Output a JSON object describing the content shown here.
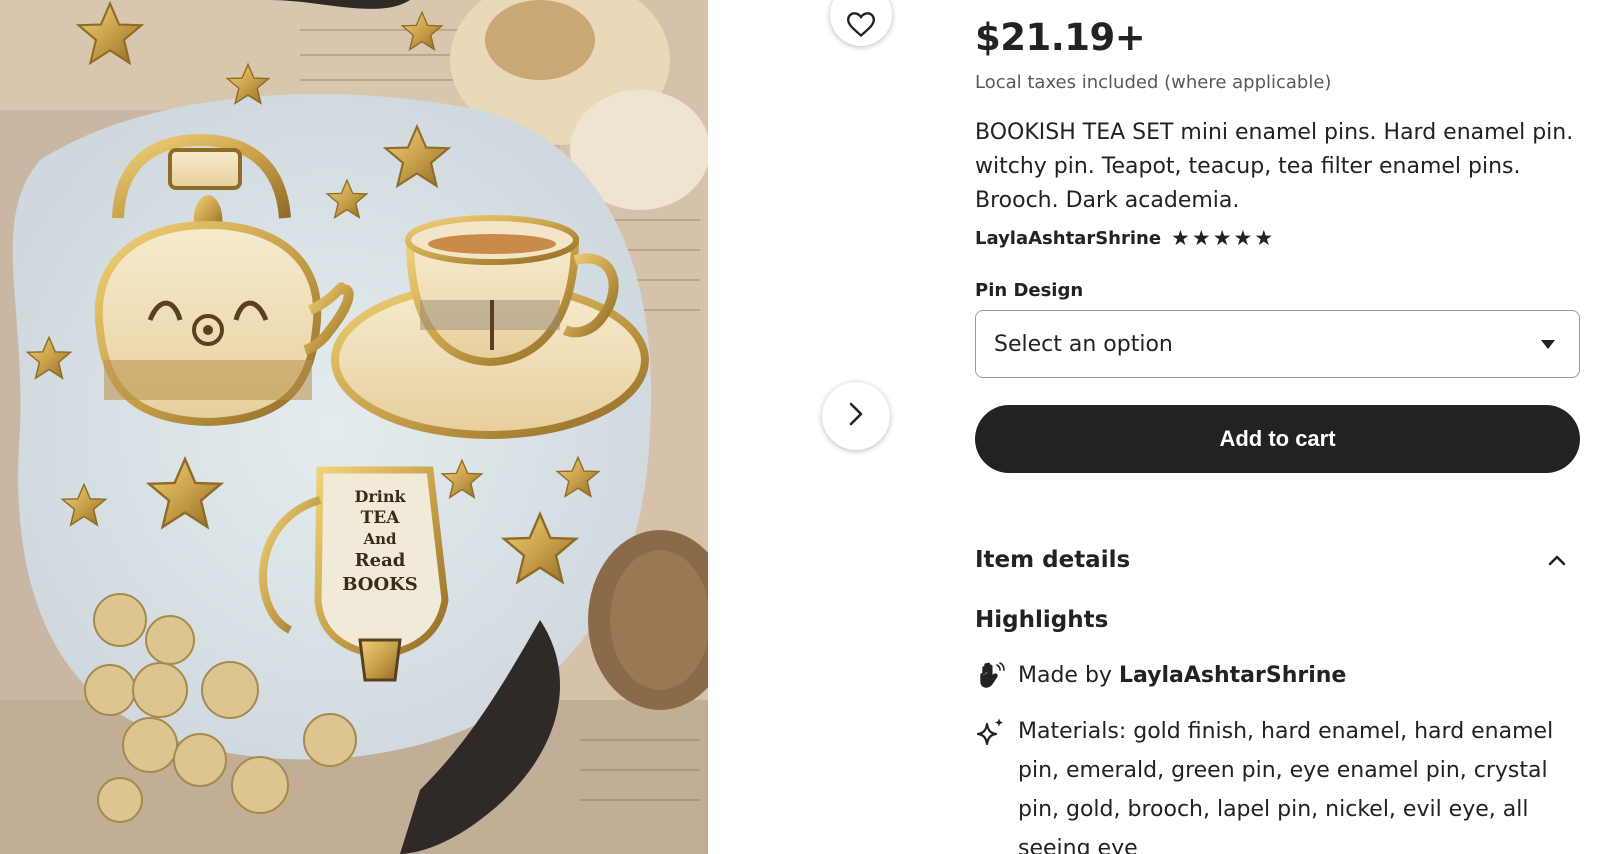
{
  "product": {
    "price": "$21.19+",
    "tax_note": "Local taxes included (where applicable)",
    "title": "BOOKISH TEA SET mini enamel pins. Hard enamel pin. witchy pin. Teapot, teacup, tea filter enamel pins. Brooch. Dark academia.",
    "shop_name": "LaylaAshtarShrine",
    "rating": 5,
    "rating_stars": [
      "★",
      "★",
      "★",
      "★",
      "★"
    ]
  },
  "photo": {
    "tag_text": [
      "Drink",
      "TEA",
      "And",
      "Read",
      "BOOKS"
    ]
  },
  "variation": {
    "label": "Pin Design",
    "selected": "Select an option"
  },
  "cart": {
    "button_label": "Add to cart"
  },
  "item_details": {
    "title": "Item details",
    "expanded": true
  },
  "highlights": {
    "title": "Highlights",
    "made_by_prefix": "Made by",
    "made_by_shop": "LaylaAshtarShrine",
    "materials": "Materials: gold finish, hard enamel, hard enamel pin, emerald, green pin, eye enamel pin, crystal pin, gold, brooch, lapel pin, nickel, evil eye, all seeing eye"
  },
  "icons": {
    "favorite": "heart-icon",
    "next": "chevron-right-icon",
    "collapse": "chevron-up-icon",
    "made_by": "hand-wave-icon",
    "materials": "sparkles-icon"
  },
  "colors": {
    "primary": "#222222",
    "muted_text": "#595959",
    "border": "#9a9a9a",
    "gold": "#c9a24a"
  }
}
